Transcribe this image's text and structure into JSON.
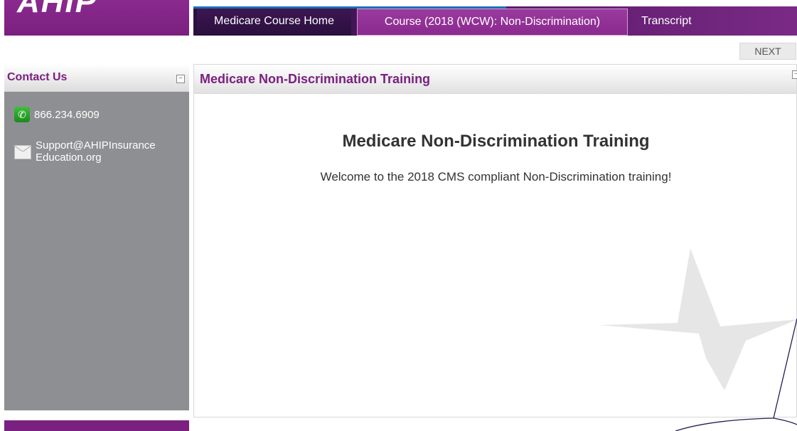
{
  "brand": {
    "logo_text": "AHIP"
  },
  "nav": {
    "tabs": [
      {
        "label": "Medicare Course Home"
      },
      {
        "label": "Course (2018 (WCW): Non-Discrimination)"
      },
      {
        "label": "Transcript"
      }
    ],
    "active_tab": "Course (2018 (WCW): Non-Discrimination)"
  },
  "toolbar": {
    "next_label": "NEXT"
  },
  "sidebar": {
    "title": "Contact Us",
    "phone": "866.234.6909",
    "email_line1": "Support@AHIPInsurance",
    "email_line2": "Education.org",
    "collapse_glyph": "−"
  },
  "main": {
    "header_title": "Medicare Non-Discrimination Training",
    "collapse_glyph": "−",
    "title": "Medicare Non-Discrimination Training",
    "welcome": "Welcome to the 2018 CMS compliant Non-Discrimination training!"
  },
  "colors": {
    "brand_purple": "#7a2080",
    "sidebar_gray": "#8e8f92",
    "nav_dark": "#2a1040"
  },
  "icons": [
    "phone-icon",
    "mail-icon",
    "collapse-icon",
    "star-watermark-icon"
  ]
}
